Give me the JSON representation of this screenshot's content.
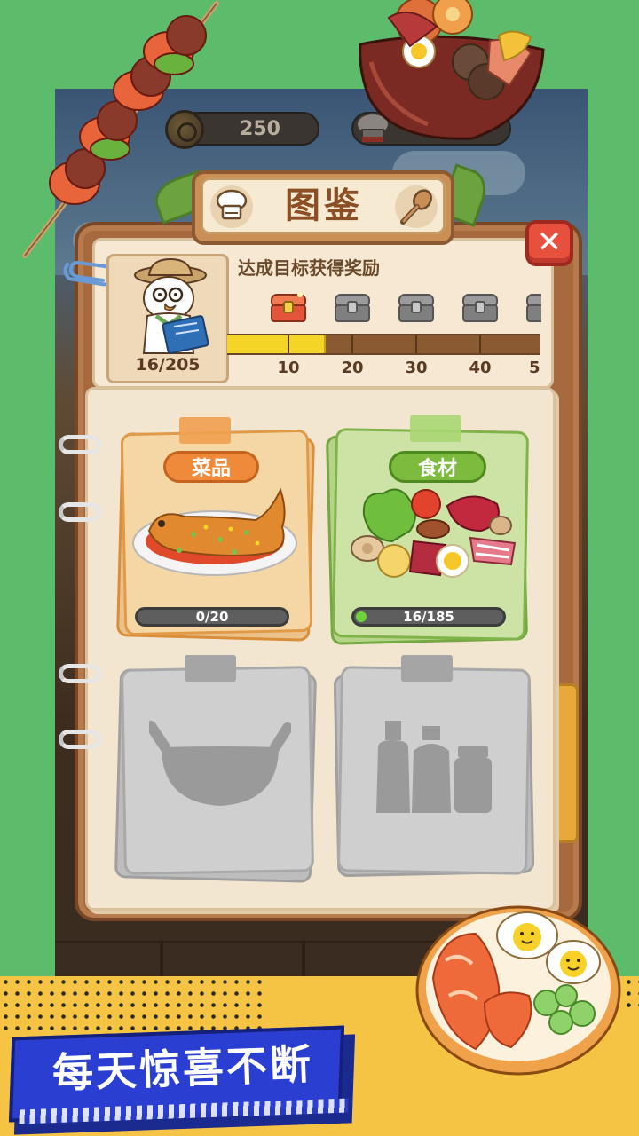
{
  "hud": {
    "coins": "250"
  },
  "book": {
    "title": "图鉴",
    "close_symbol": "✕"
  },
  "explorer": {
    "count": "16/205",
    "goal_label": "达成目标获得奖励",
    "progress_value": 16,
    "milestones": [
      "10",
      "20",
      "30",
      "40",
      "5"
    ]
  },
  "categories": [
    {
      "label": "菜品",
      "progress": "0/20",
      "color": "#ef8a3a"
    },
    {
      "label": "食材",
      "progress": "16/185",
      "color": "#7cbb3e"
    }
  ],
  "promo": {
    "slogan": "每天惊喜不断"
  },
  "colors": {
    "background": "#5dbb6c",
    "close_red": "#e8503e",
    "progress_yellow": "#f5d428",
    "banner_blue": "#2a3ed1",
    "promo_yellow": "#f6c445"
  },
  "icons": {
    "coin": "coin-icon",
    "chef_hat": "chef-hat-icon",
    "spoon": "spoon-icon",
    "close": "close-icon",
    "chest": "treasure-chest-icon",
    "lock_pot": "wok-silhouette-icon",
    "lock_bottles": "condiment-bottles-silhouette-icon"
  }
}
